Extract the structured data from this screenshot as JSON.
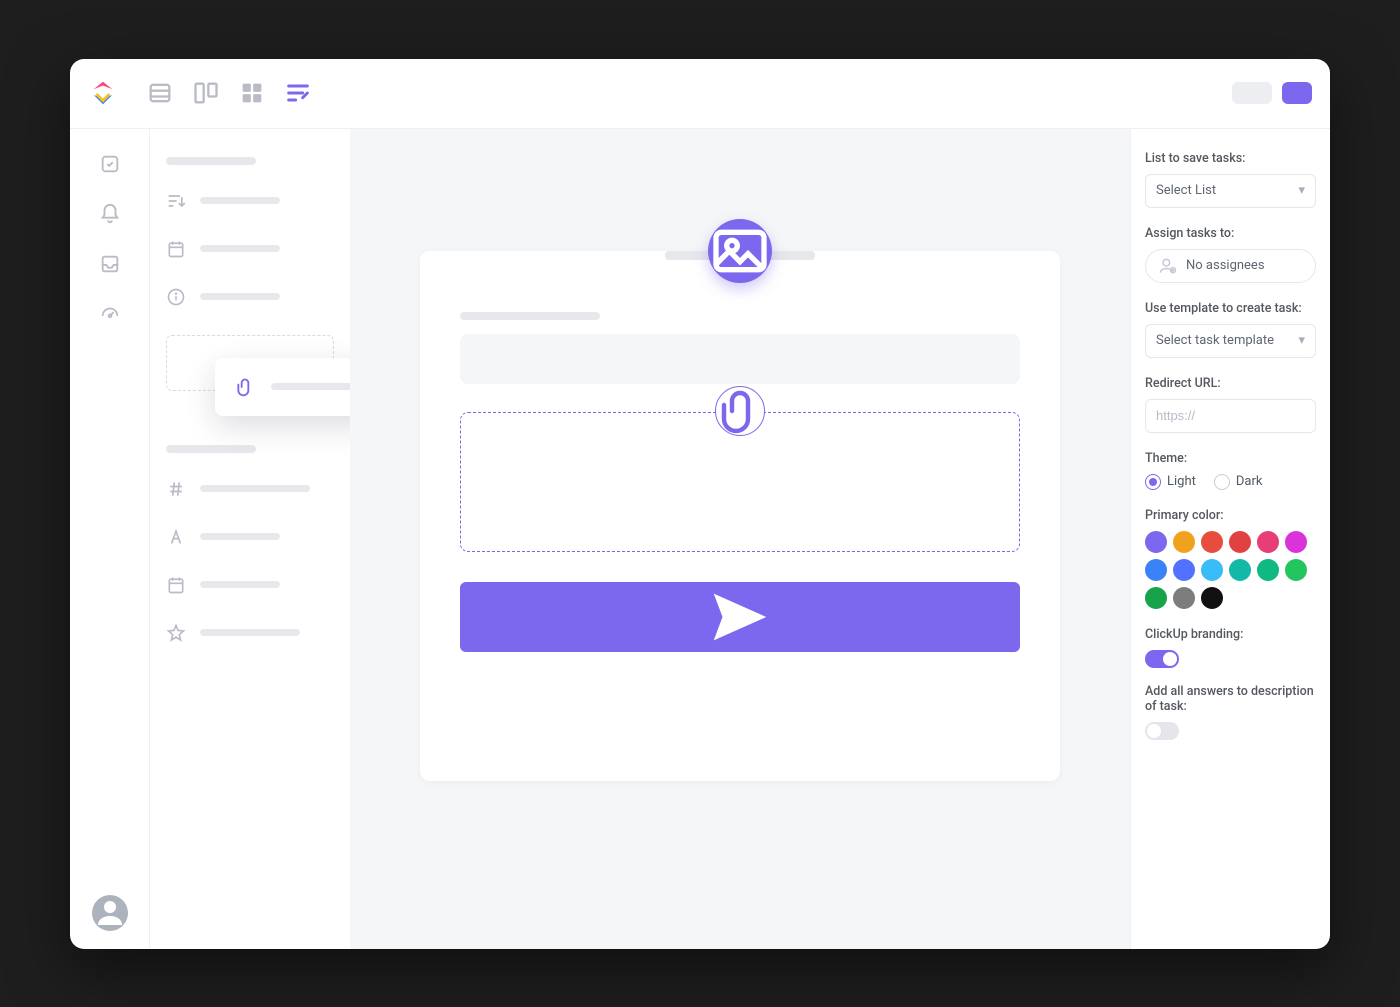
{
  "header": {
    "view_tabs": [
      "list",
      "board",
      "box",
      "form"
    ],
    "active_view": "form"
  },
  "nav_rail": {
    "items": [
      "tasks",
      "notifications",
      "inbox",
      "dashboard"
    ]
  },
  "fields_panel": {
    "group1_items": [
      "sort",
      "date",
      "info"
    ],
    "dragging_item": "attachment",
    "group2_items": [
      "hash",
      "text",
      "date2",
      "star"
    ]
  },
  "form_preview": {
    "has_logo": true,
    "has_title_placeholder": true,
    "has_text_field": true,
    "attachment_drop": true
  },
  "settings": {
    "list_label": "List to save tasks:",
    "list_select": "Select List",
    "assign_label": "Assign tasks to:",
    "assign_value": "No assignees",
    "template_label": "Use template to create task:",
    "template_select": "Select task template",
    "redirect_label": "Redirect URL:",
    "redirect_placeholder": "https://",
    "theme_label": "Theme:",
    "theme_light": "Light",
    "theme_dark": "Dark",
    "theme_selected": "light",
    "primary_color_label": "Primary color:",
    "colors": [
      "#7b68ee",
      "#f0a21f",
      "#e74c3c",
      "#e04242",
      "#e83e78",
      "#d933d9",
      "#3b82f6",
      "#5271ff",
      "#38bdf8",
      "#14b8a6",
      "#10b981",
      "#22c55e",
      "#16a34a",
      "#7d7d7d",
      "#111111"
    ],
    "branding_label": "ClickUp branding:",
    "branding_on": true,
    "add_answers_label": "Add all answers to description of task:",
    "add_answers_on": false
  }
}
